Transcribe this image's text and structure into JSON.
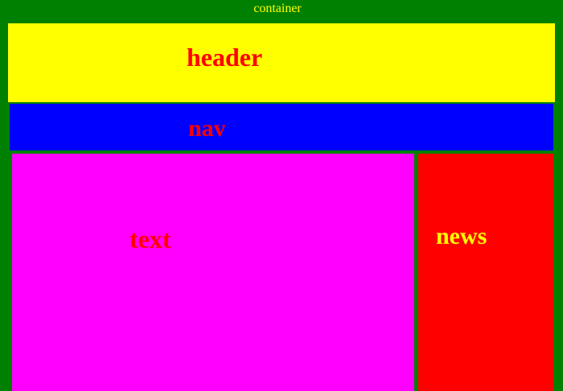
{
  "container": {
    "label": "container",
    "background": "#008000",
    "text_color": "#ffff00"
  },
  "header": {
    "label": "header",
    "background": "#ffff00",
    "text_color": "#ff0000"
  },
  "nav": {
    "label": "nav",
    "background": "#0000ff",
    "text_color": "#ff0000"
  },
  "text": {
    "label": "text",
    "background": "#ff00ff",
    "text_color": "#ff0000"
  },
  "news": {
    "label": "news",
    "background": "#ff0000",
    "text_color": "#ffff00"
  }
}
